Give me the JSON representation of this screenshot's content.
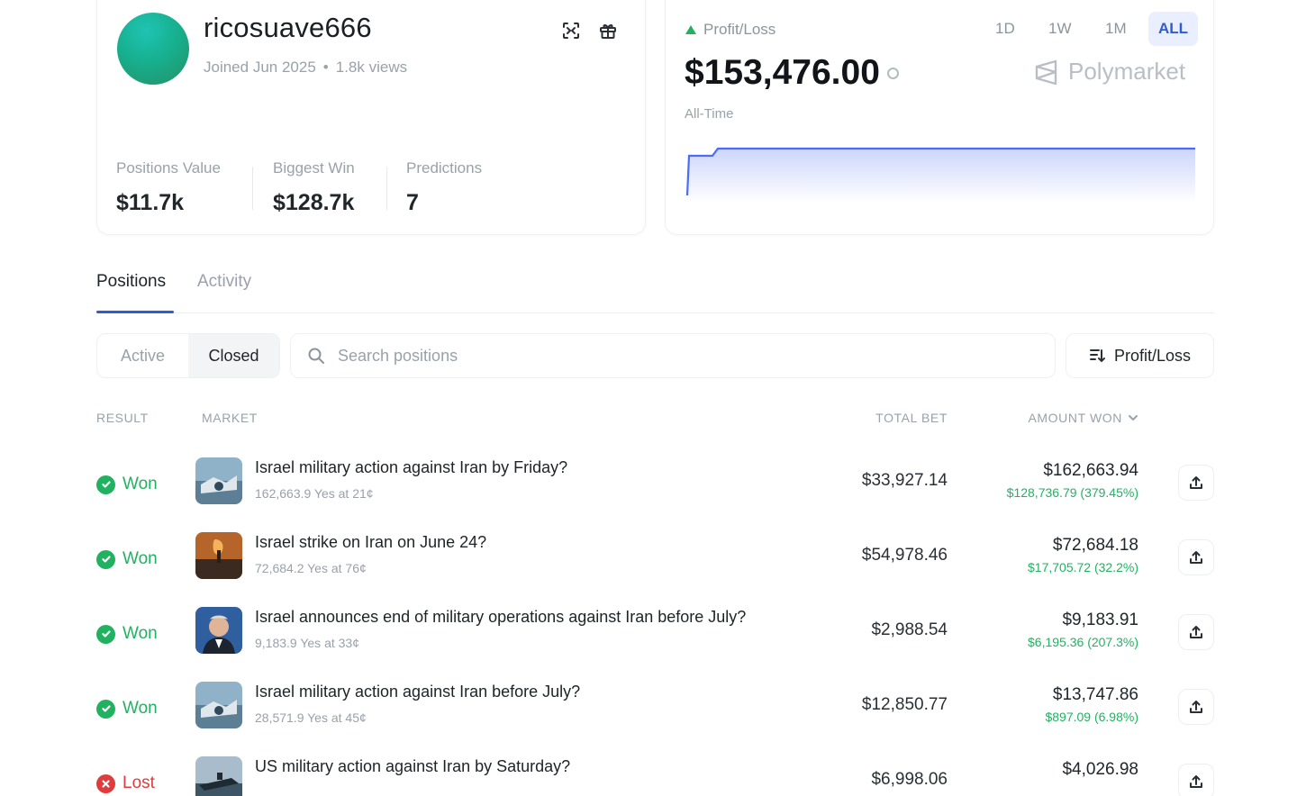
{
  "profile": {
    "username": "ricosuave666",
    "joined": "Joined Jun 2025",
    "views": "1.8k views",
    "stats": [
      {
        "label": "Positions Value",
        "value": "$11.7k"
      },
      {
        "label": "Biggest Win",
        "value": "$128.7k"
      },
      {
        "label": "Predictions",
        "value": "7"
      }
    ]
  },
  "pnl": {
    "label": "Profit/Loss",
    "value": "$153,476.00",
    "period": "All-Time",
    "brand": "Polymarket",
    "ranges": [
      "1D",
      "1W",
      "1M",
      "ALL"
    ],
    "selected_range": "ALL",
    "line_color": "#4a6cf7"
  },
  "tabs": [
    "Positions",
    "Activity"
  ],
  "filters": {
    "active": "Active",
    "closed": "Closed",
    "search_placeholder": "Search positions",
    "sort": "Profit/Loss"
  },
  "table": {
    "headers": {
      "result": "RESULT",
      "market": "MARKET",
      "total_bet": "TOTAL BET",
      "amount_won": "AMOUNT WON"
    },
    "rows": [
      {
        "result": "Won",
        "title": "Israel military action against Iran by Friday?",
        "sub": "162,663.9 Yes at 21¢",
        "total_bet": "$33,927.14",
        "amount_won": "$162,663.94",
        "pnl": "$128,736.79 (379.45%)"
      },
      {
        "result": "Won",
        "title": "Israel strike on Iran on June 24?",
        "sub": "72,684.2 Yes at 76¢",
        "total_bet": "$54,978.46",
        "amount_won": "$72,684.18",
        "pnl": "$17,705.72 (32.2%)"
      },
      {
        "result": "Won",
        "title": "Israel announces end of military operations against Iran before July?",
        "sub": "9,183.9 Yes at 33¢",
        "total_bet": "$2,988.54",
        "amount_won": "$9,183.91",
        "pnl": "$6,195.36 (207.3%)"
      },
      {
        "result": "Won",
        "title": "Israel military action against Iran before July?",
        "sub": "28,571.9 Yes at 45¢",
        "total_bet": "$12,850.77",
        "amount_won": "$13,747.86",
        "pnl": "$897.09 (6.98%)"
      },
      {
        "result": "Lost",
        "title": "US military action against Iran by Saturday?",
        "sub": "",
        "total_bet": "$6,998.06",
        "amount_won": "$4,026.98",
        "pnl": ""
      }
    ]
  },
  "colors": {
    "won": "#21b261",
    "lost": "#e23b3b",
    "accent": "#2f5bd8"
  }
}
